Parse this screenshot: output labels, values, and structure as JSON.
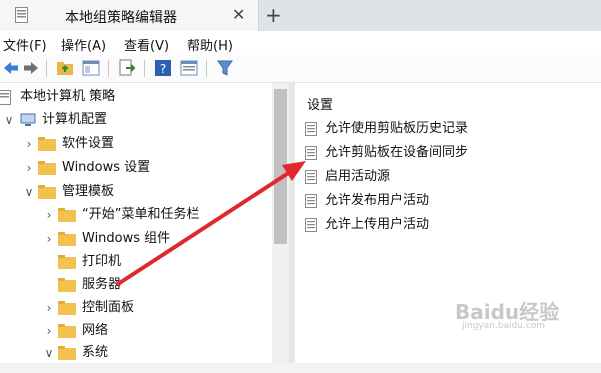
{
  "tab": {
    "title": "本地组策略编辑器",
    "close_glyph": "✕",
    "new_tab_glyph": "+"
  },
  "menu": [
    "文件(F)",
    "操作(A)",
    "查看(V)",
    "帮助(H)"
  ],
  "toolbar": {
    "icons": [
      "back-icon",
      "forward-icon",
      "up-folder-icon",
      "show-hide-tree-icon",
      "export-list-icon",
      "help-icon",
      "properties-icon",
      "filter-icon"
    ]
  },
  "tree": {
    "items": [
      {
        "label": "本地计算机 策略",
        "chevron": ""
      },
      {
        "label": "计算机配置",
        "chevron": "v"
      },
      {
        "label": "软件设置",
        "chevron": ">"
      },
      {
        "label": "Windows 设置",
        "chevron": ">"
      },
      {
        "label": "管理模板",
        "chevron": "v"
      },
      {
        "label": "“开始”菜单和任务栏",
        "chevron": ">"
      },
      {
        "label": "Windows 组件",
        "chevron": ">"
      },
      {
        "label": "打印机",
        "chevron": ""
      },
      {
        "label": "服务器",
        "chevron": ""
      },
      {
        "label": "控制面板",
        "chevron": ">"
      },
      {
        "label": "网络",
        "chevron": ">"
      },
      {
        "label": "系统",
        "chevron": "v"
      }
    ]
  },
  "settings": {
    "header": "设置",
    "items": [
      "允许使用剪贴板历史记录",
      "允许剪贴板在设备间同步",
      "启用活动源",
      "允许发布用户活动",
      "允许上传用户活动"
    ]
  },
  "watermark": {
    "text": "Baidu经验",
    "sub": "jingyan.baidu.com"
  },
  "colors": {
    "folder": "#f2c14e",
    "arrow": "#e0282e",
    "tabbar": "#dfe3e8"
  }
}
